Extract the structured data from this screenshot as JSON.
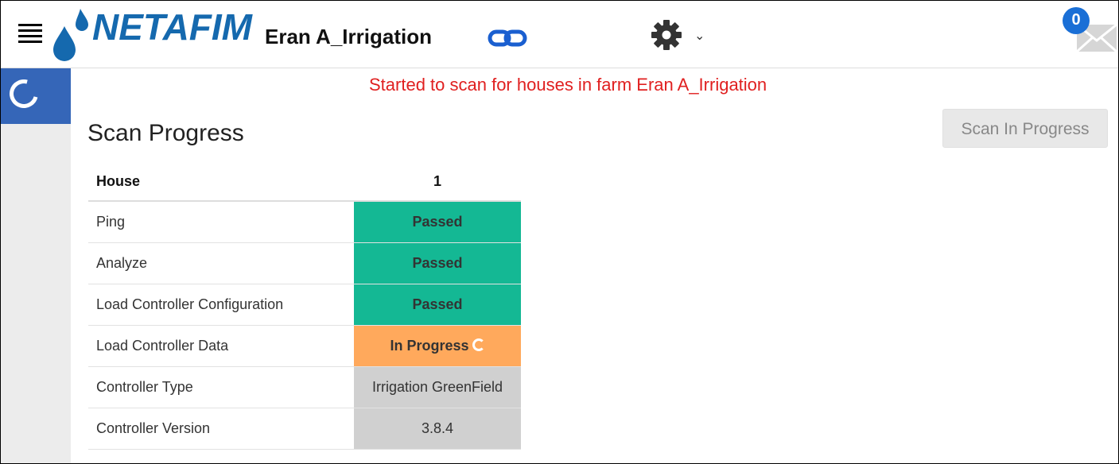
{
  "header": {
    "brand": "NETAFIM",
    "farm_name": "Eran A_Irrigation",
    "notifications_count": "0",
    "icons": [
      "menu-icon",
      "link-icon",
      "gear-icon",
      "chevron-down-icon",
      "mail-icon"
    ]
  },
  "main": {
    "status_message": "Started to scan for houses in farm Eran A_Irrigation",
    "title": "Scan Progress",
    "scan_button_label": "Scan In Progress",
    "table": {
      "header_label": "House",
      "header_value": "1",
      "rows": [
        {
          "label": "Ping",
          "value": "Passed",
          "status": "passed"
        },
        {
          "label": "Analyze",
          "value": "Passed",
          "status": "passed"
        },
        {
          "label": "Load Controller Configuration",
          "value": "Passed",
          "status": "passed"
        },
        {
          "label": "Load Controller Data",
          "value": "In Progress",
          "status": "in-progress"
        },
        {
          "label": "Controller Type",
          "value": "Irrigation GreenField",
          "status": "info"
        },
        {
          "label": "Controller Version",
          "value": "3.8.4",
          "status": "info"
        }
      ]
    }
  },
  "colors": {
    "brand_blue": "#1569ae",
    "passed": "#14b894",
    "in_progress": "#ffa95c",
    "info": "#d0d0d0",
    "alert_text": "#e02020",
    "sidebar_active": "#3566b8"
  }
}
